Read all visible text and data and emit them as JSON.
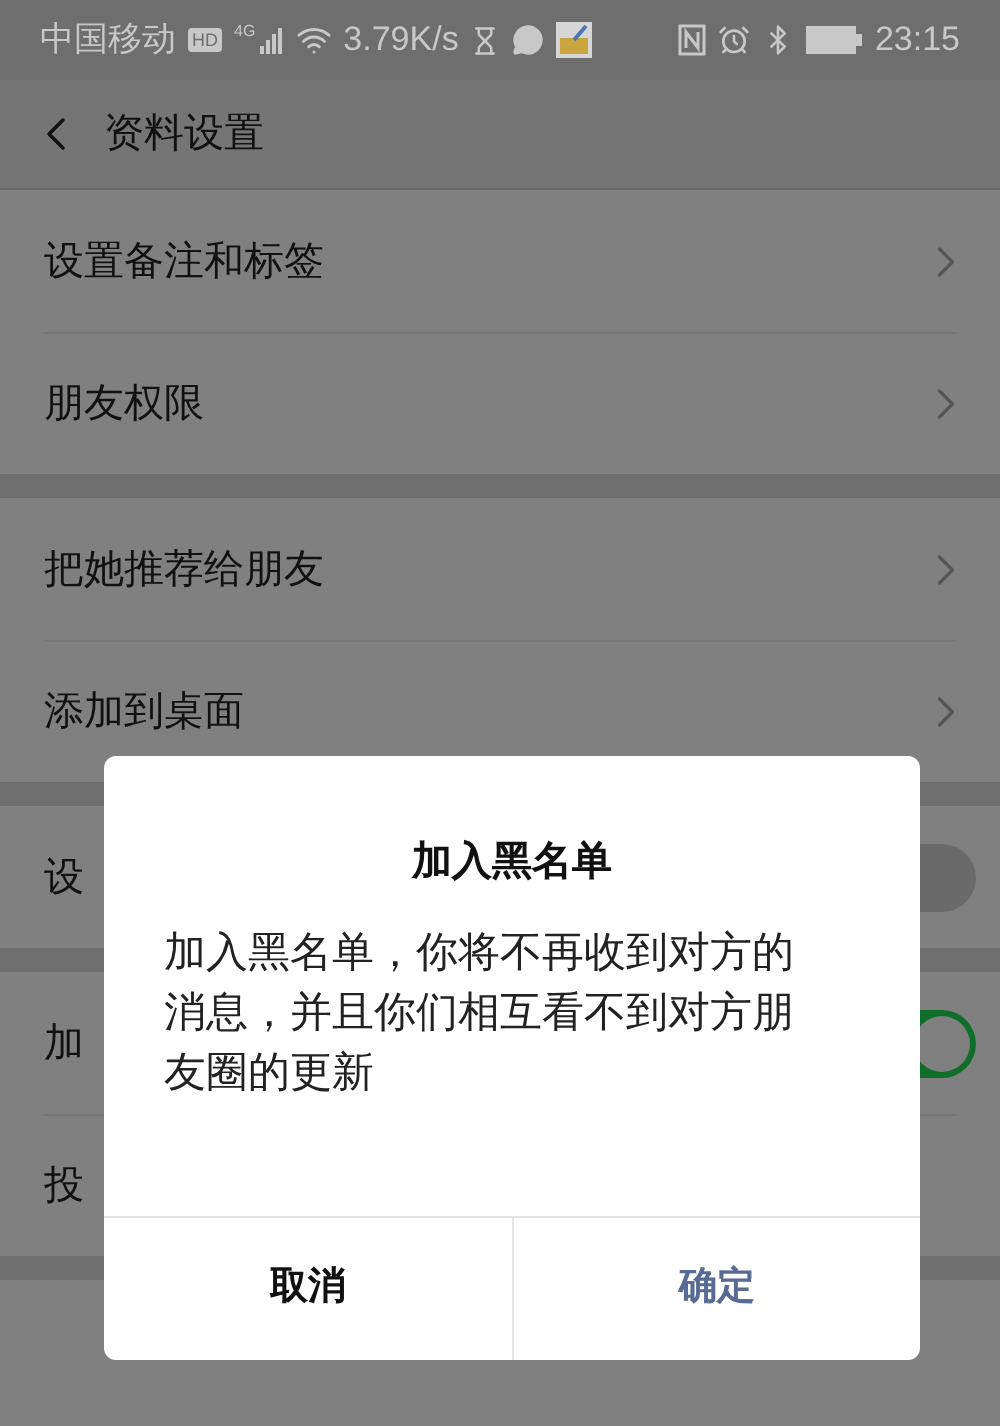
{
  "status_bar": {
    "carrier": "中国移动",
    "hd": "HD",
    "network": "4G",
    "speed": "3.79K/s",
    "time": "23:15"
  },
  "header": {
    "title": "资料设置"
  },
  "sections": [
    {
      "rows": [
        {
          "label": "设置备注和标签",
          "kind": "link"
        },
        {
          "label": "朋友权限",
          "kind": "link"
        }
      ]
    },
    {
      "rows": [
        {
          "label": "把她推荐给朋友",
          "kind": "link"
        },
        {
          "label": "添加到桌面",
          "kind": "link"
        }
      ]
    },
    {
      "rows": [
        {
          "label": "设",
          "kind": "switch",
          "on": false
        }
      ]
    },
    {
      "rows": [
        {
          "label": "加",
          "kind": "switch",
          "on": true
        },
        {
          "label": "投",
          "kind": "plain"
        }
      ]
    }
  ],
  "dialog": {
    "title": "加入黑名单",
    "message": "加入黑名单，你将不再收到对方的消息，并且你们相互看不到对方朋友圈的更新",
    "buttons": [
      {
        "label": "取消",
        "kind": "cancel"
      },
      {
        "label": "确定",
        "kind": "confirm"
      }
    ]
  }
}
